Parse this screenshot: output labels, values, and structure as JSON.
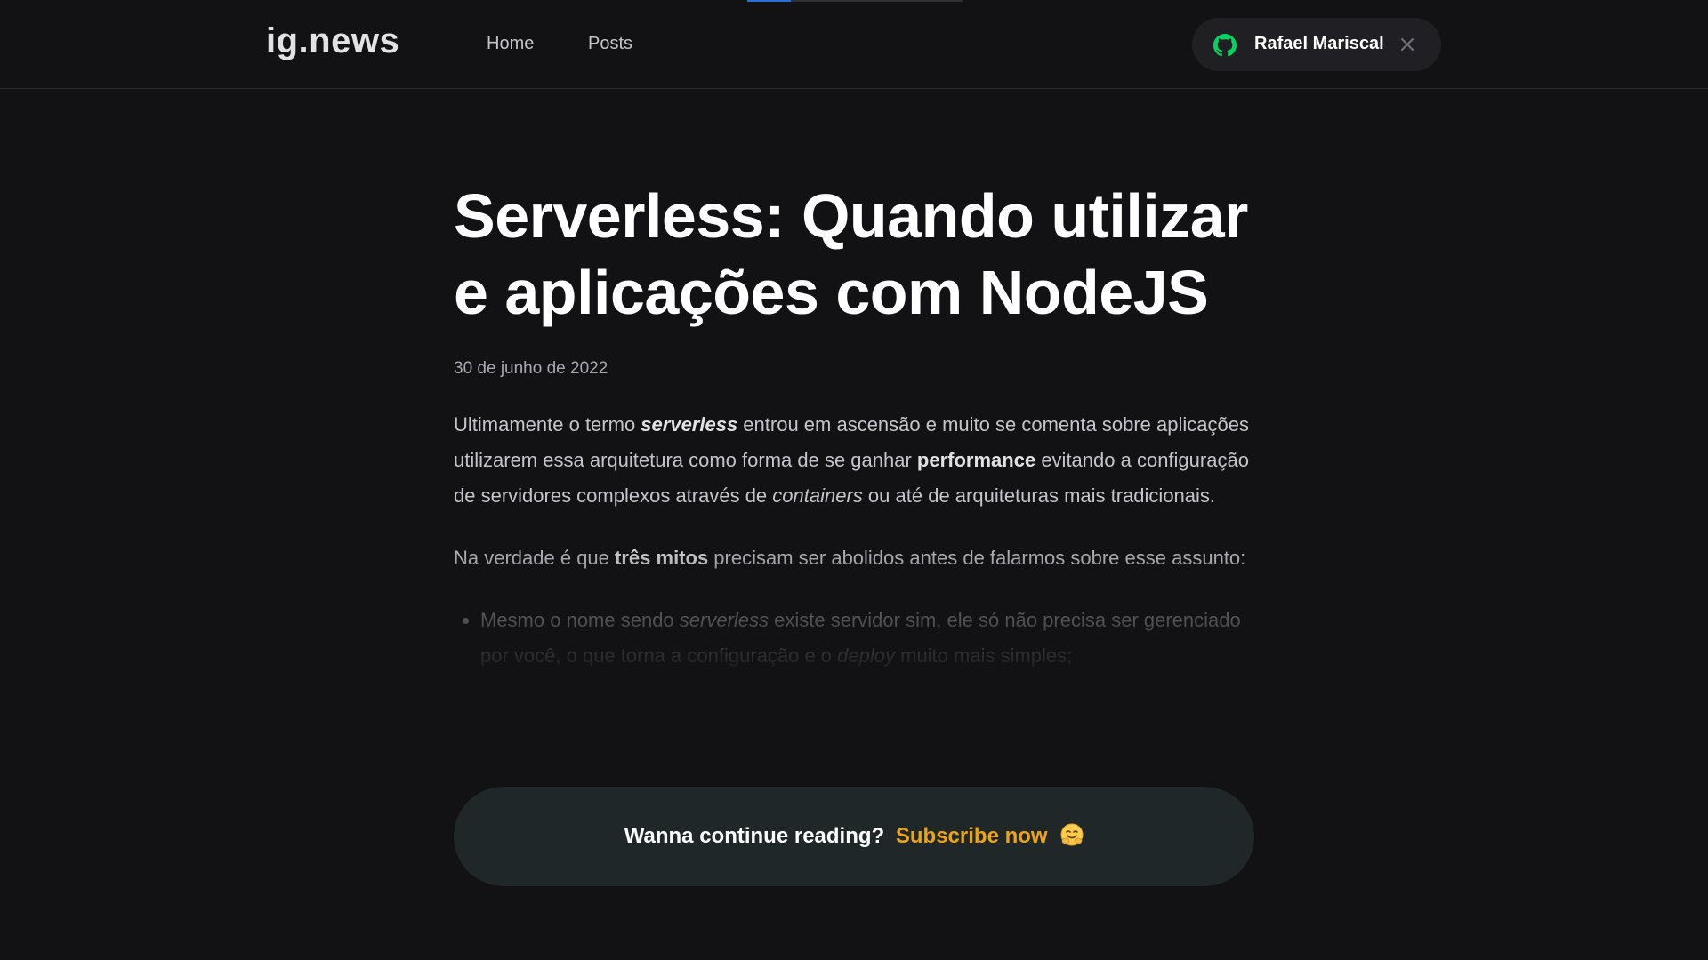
{
  "header": {
    "logo": "ig.news",
    "nav": [
      {
        "label": "Home"
      },
      {
        "label": "Posts"
      }
    ],
    "user": {
      "name": "Rafael Mariscal",
      "icon": "github-icon",
      "close_icon": "close-icon"
    }
  },
  "article": {
    "title_line1": "Serverless: Quando utilizar",
    "title_line2": "e aplicações com NodeJS",
    "date": "30 de junho de 2022",
    "p1": {
      "t1": "Ultimamente o termo ",
      "b1": "serverless",
      "t2": " entrou em ascensão e muito se comenta sobre aplicações utilizarem essa arquitetura como forma de se ganhar ",
      "b2": "performance",
      "t3": " evitando a configuração de servidores complexos através de ",
      "i1": "containers",
      "t4": " ou até de arquiteturas mais tradicionais."
    },
    "p2": {
      "t1": "Na verdade é que ",
      "b1": "três mitos",
      "t2": " precisam ser abolidos antes de falarmos sobre esse assunto:"
    },
    "li1": {
      "t1": "Mesmo o nome sendo ",
      "i1": "serverless",
      "t2": " existe servidor sim, ele só não precisa ser gerenciado por você, o que torna a configuração e o ",
      "i2": "deploy",
      "t3": " muito mais simples;"
    }
  },
  "cta": {
    "text": "Wanna continue reading?",
    "link": "Subscribe now",
    "emoji": "hugging-face-emoji"
  },
  "colors": {
    "background": "#121214",
    "accent": "#eba417",
    "github_green": "#04d361",
    "cta_bg": "#1f2729"
  }
}
